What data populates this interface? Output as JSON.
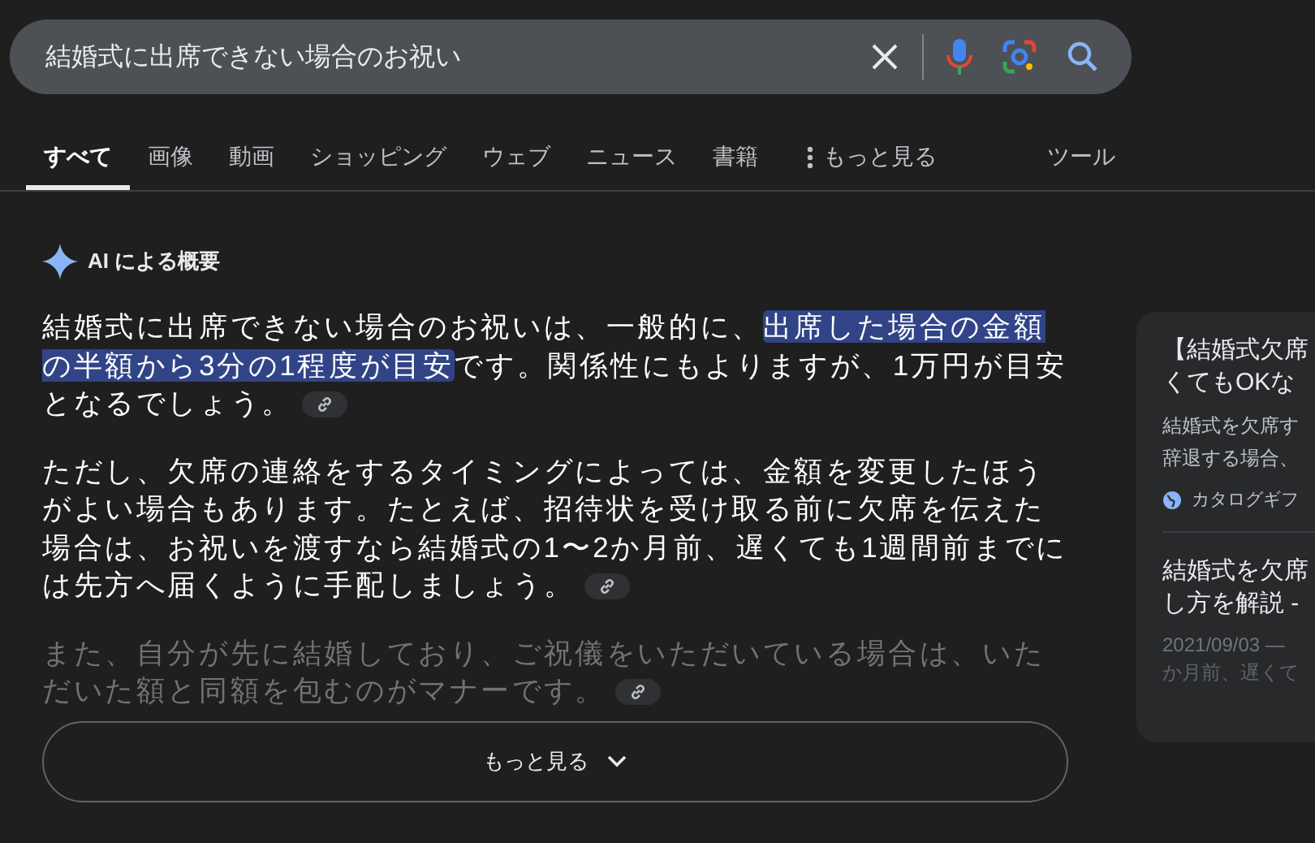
{
  "search": {
    "value": "結婚式に出席できない場合のお祝い"
  },
  "tabs": [
    {
      "label": "すべて",
      "selected": true
    },
    {
      "label": "画像",
      "selected": false
    },
    {
      "label": "動画",
      "selected": false
    },
    {
      "label": "ショッピング",
      "selected": false
    },
    {
      "label": "ウェブ",
      "selected": false
    },
    {
      "label": "ニュース",
      "selected": false
    },
    {
      "label": "書籍",
      "selected": false
    },
    {
      "label": "もっと見る",
      "selected": false,
      "kind": "more"
    }
  ],
  "tools_label": "ツール",
  "overview": {
    "title": "AI による概要",
    "paragraphs": [
      {
        "faded": false,
        "link": true,
        "segments": [
          {
            "text": "結婚式に出席できない場合のお祝いは、一般的に、",
            "highlighted": false
          },
          {
            "text": "出席した場合の金額の半額から3分の1程度が目安",
            "highlighted": true
          },
          {
            "text": "です。関係性にもよりますが、1万円が目安となるでしょう。",
            "highlighted": false
          }
        ]
      },
      {
        "faded": false,
        "link": true,
        "segments": [
          {
            "text": "ただし、欠席の連絡をするタイミングによっては、金額を変更したほうがよい場合もあります。たとえば、招待状を受け取る前に欠席を伝えた場合は、お祝いを渡すなら結婚式の1〜2か月前、遅くても1週間前までには先方へ届くように手配しましょう。",
            "highlighted": false
          }
        ]
      },
      {
        "faded": true,
        "link": true,
        "segments": [
          {
            "text": "また、自分が先に結婚しており、ご祝儀をいただいている場合は、いただいた額と同額を包むのがマナーです。",
            "highlighted": false
          }
        ]
      }
    ],
    "more_button": "もっと見る"
  },
  "sources": [
    {
      "title": [
        "【結婚式欠席",
        "くてもOKな"
      ],
      "snippet": [
        "結婚式を欠席す",
        "辞退する場合、"
      ],
      "site": "カタログギフ"
    },
    {
      "title": [
        "結婚式を欠席",
        "し方を解説 -"
      ],
      "date": "2021/09/03 —",
      "snippet": [
        "か月前、遅くて"
      ]
    }
  ]
}
